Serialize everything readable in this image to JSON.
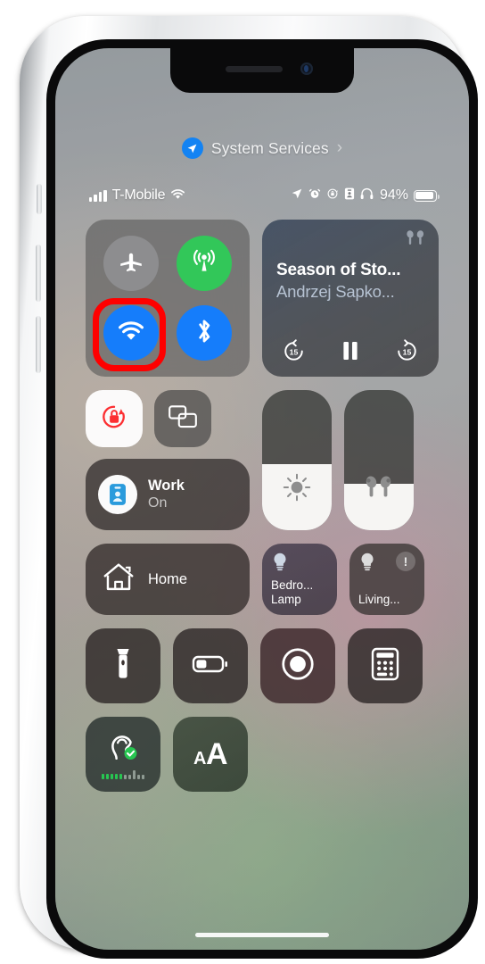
{
  "device": {
    "name": "iPhone",
    "frame_color": "silver"
  },
  "header": {
    "icon": "location-arrow-icon",
    "title": "System Services",
    "chevron": "›"
  },
  "status_bar": {
    "signal_icon": "cellular-signal-icon",
    "carrier": "T-Mobile",
    "wifi_icon": "wifi-icon",
    "right_icons": [
      "location-arrow-icon",
      "alarm-clock-icon",
      "rotation-lock-icon",
      "focus-work-badge-icon",
      "headphones-icon"
    ],
    "battery_percent": "94%",
    "battery_fill": 94,
    "battery_icon": "battery-icon"
  },
  "control_center": {
    "connectivity": {
      "label": "Connectivity",
      "toggles": [
        {
          "name": "airplane-mode",
          "icon": "airplane-icon",
          "state": "off",
          "color": "#8d8d8f"
        },
        {
          "name": "cellular-data",
          "icon": "cellular-antenna-icon",
          "state": "on",
          "color": "#32c759"
        },
        {
          "name": "wifi",
          "icon": "wifi-icon",
          "state": "on",
          "color": "#157dfb",
          "highlighted": true
        },
        {
          "name": "bluetooth",
          "icon": "bluetooth-icon",
          "state": "on",
          "color": "#157dfb"
        }
      ],
      "highlight_color": "#fe0000"
    },
    "now_playing": {
      "route_icon": "airpods-icon",
      "title": "Season of Sto...",
      "artist": "Andrzej Sapko...",
      "skip_back_label": "15",
      "skip_forward_label": "15",
      "play_state": "paused",
      "play_icon": "pause-icon",
      "skip_back_icon": "skip-back-15-icon",
      "skip_forward_icon": "skip-forward-15-icon"
    },
    "rotation_lock": {
      "icon": "rotation-lock-icon",
      "state": "on",
      "color": "#ff3b30"
    },
    "screen_mirroring": {
      "icon": "screen-mirroring-icon",
      "state": "off"
    },
    "focus": {
      "icon": "work-badge-icon",
      "name": "Work",
      "state": "On",
      "icon_color": "#2a9bdc"
    },
    "brightness": {
      "icon": "brightness-icon",
      "value": 47
    },
    "volume": {
      "icon": "airpods-icon",
      "value": 33
    },
    "home": {
      "icon": "home-icon",
      "label": "Home"
    },
    "accessories": [
      {
        "name": "bedroom-lamp",
        "icon": "lightbulb-icon",
        "label_line1": "Bedro...",
        "label_line2": "Lamp",
        "has_alert": false
      },
      {
        "name": "living-room",
        "icon": "lightbulb-icon",
        "label_line1": "Living...",
        "label_line2": "",
        "has_alert": true,
        "alert_icon": "exclamation-icon",
        "alert_glyph": "!"
      }
    ],
    "utilities": [
      {
        "name": "flashlight",
        "icon": "flashlight-icon"
      },
      {
        "name": "low-power-mode",
        "icon": "battery-icon"
      },
      {
        "name": "screen-recording",
        "icon": "record-icon"
      },
      {
        "name": "calculator",
        "icon": "calculator-icon"
      }
    ],
    "accessibility": [
      {
        "name": "hearing",
        "icon": "ear-hearing-icon",
        "badge_icon": "checkmark-icon",
        "badge_color": "#27c651"
      },
      {
        "name": "text-size",
        "icon": "text-size-icon",
        "glyph_small": "A",
        "glyph_large": "A"
      }
    ]
  },
  "home_indicator": {
    "name": "home-indicator"
  }
}
